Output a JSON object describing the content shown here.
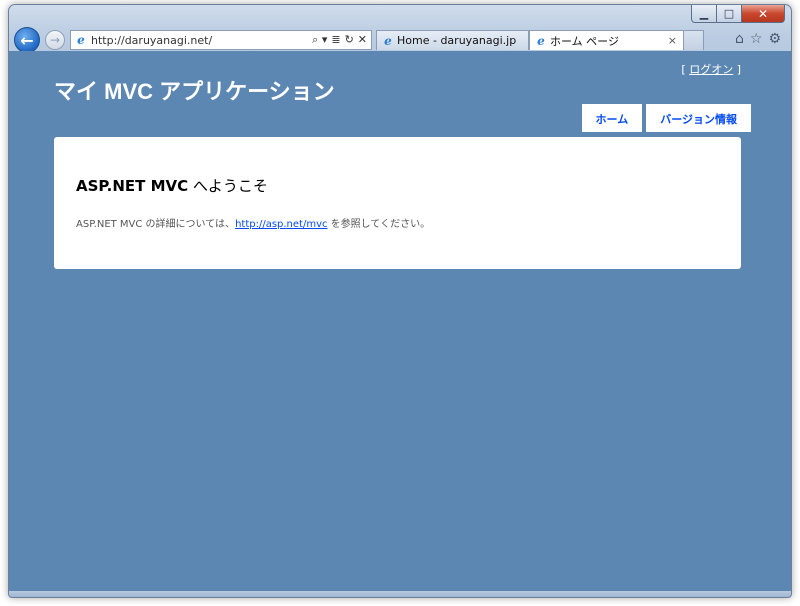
{
  "browser": {
    "address": {
      "url": "http://daruyanagi.net/",
      "tools": [
        "⌕ ▾",
        "≣",
        "↻",
        "✕"
      ]
    },
    "tabs": [
      {
        "label": "Home - daruyanagi.jp"
      },
      {
        "label": "ホーム ページ",
        "close": "×"
      }
    ],
    "icons": [
      "home-icon",
      "favorites-star-icon",
      "tools-gear-icon"
    ]
  },
  "page": {
    "login_prefix": "[ ",
    "login_link": "ログオン",
    "login_suffix": " ]",
    "site_title": "マイ MVC アプリケーション",
    "menu": [
      {
        "label": "ホーム"
      },
      {
        "label": "バージョン情報"
      }
    ],
    "heading_bold": "ASP.NET MVC",
    "heading_rest": " へようこそ",
    "body_prefix": "ASP.NET MVC の詳細については、",
    "body_link": "http://asp.net/mvc",
    "body_suffix": " を参照してください。"
  },
  "colors": {
    "page_background": "#5c87b2",
    "link": "#034af3",
    "panel": "#ffffff"
  }
}
